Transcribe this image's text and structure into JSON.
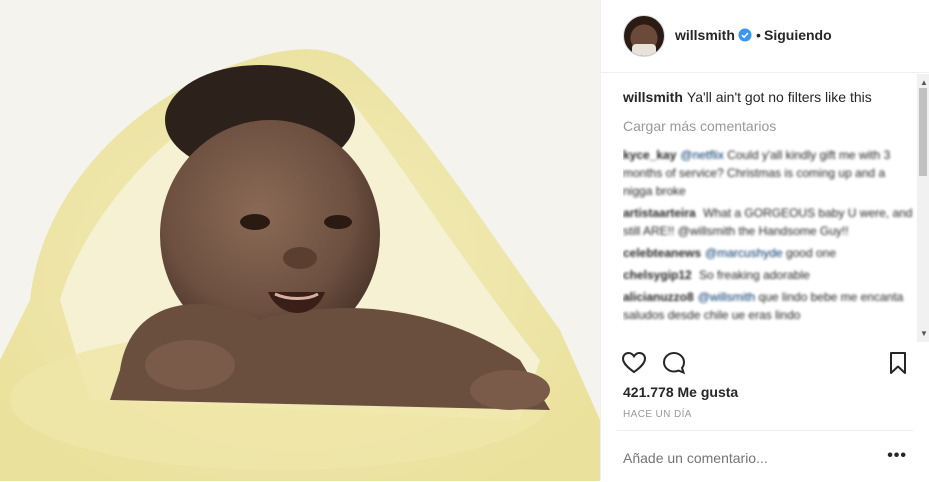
{
  "post": {
    "username": "willsmith",
    "separator": "•",
    "follow_status": "Siguiendo",
    "caption_user": "willsmith",
    "caption_text": "Ya'll ain't got no filters like this",
    "load_more": "Cargar más comentarios",
    "comments": [
      {
        "user": "kyce_kay",
        "mention": "@netflix",
        "text": "Could y'all kindly gift me with 3 months of service? Christmas is coming up and a nigga broke"
      },
      {
        "user": "artistaarteira",
        "mention": "",
        "text": "What a GORGEOUS baby U were, and still ARE!! @willsmith the Handsome Guy!!"
      },
      {
        "user": "celebteanews",
        "mention": "@marcushyde",
        "text": "good one"
      },
      {
        "user": "chelsygip12",
        "mention": "",
        "text": "So freaking adorable"
      },
      {
        "user": "alicianuzzo8",
        "mention": "@willsmith",
        "text": "que lindo bebe me encanta saludos desde chile ue eras lindo"
      }
    ],
    "likes": "421.778 Me gusta",
    "timestamp": "HACE UN DÍA",
    "comment_placeholder": "Añade un comentario...",
    "more_options": "•••"
  },
  "icons": {
    "verified": "verified-badge-icon",
    "like": "heart-icon",
    "comment": "comment-bubble-icon",
    "save": "bookmark-icon"
  },
  "colors": {
    "verified": "#3897f0",
    "muted": "#999999",
    "border": "#efefef"
  }
}
